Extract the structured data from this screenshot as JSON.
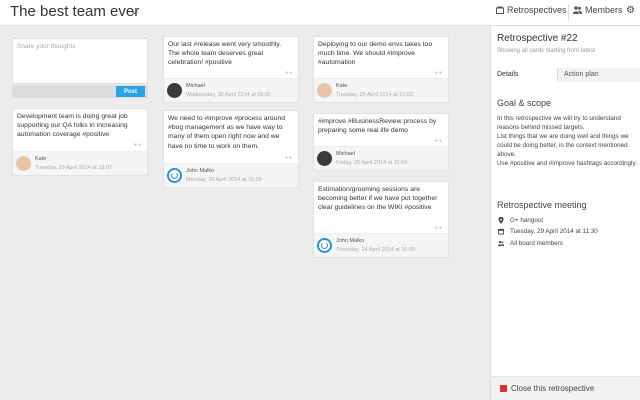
{
  "header": {
    "board_title": "The best team ever",
    "retrospectives_label": "Retrospectives",
    "members_label": "Members"
  },
  "composer": {
    "placeholder": "Share your thoughts",
    "post_label": "Post"
  },
  "cards": [
    {
      "text": "Development team is doing great job supporting our QA folks in increasing automation coverage #positive",
      "author": "Kate",
      "date": "Tuesday, 29 April 2014 at 18:07",
      "avatar": "photo"
    },
    {
      "text": "Our last #release went very smoothly. The whole team deserves great celebration! #positive",
      "author": "Michael",
      "date": "Wednesday, 30 April 2014 at 09:05",
      "avatar": "photo-dark"
    },
    {
      "text": "We need to #improve #process around #bug management as we have way to many of them open right now and we have no time to work on them.",
      "author": "John Malko",
      "date": "Monday, 28 April 2014 at 16:09",
      "avatar": "logo-blue"
    },
    {
      "text": "Deploying to our demo envs takes too much time. We should #improve #automation",
      "author": "Kate",
      "date": "Tuesday, 29 April 2014 at 21:03",
      "avatar": "photo"
    },
    {
      "text": "#improve #BusinessReview process by preparing some real life demo",
      "author": "Michael",
      "date": "Friday, 25 April 2014 at 11:04",
      "avatar": "photo-dark"
    },
    {
      "text": "Estimation/grooming sessions are becoming better if we have put together clear guidelines on the WIKI #positive",
      "author": "John Malko",
      "date": "Thursday, 24 April 2014 at 16:09",
      "avatar": "logo-blue"
    }
  ],
  "panel": {
    "title": "Retrospective #22",
    "subtitle": "Showing all cards starting from latest",
    "tabs": [
      "Details",
      "Action plan"
    ],
    "goal_title": "Goal & scope",
    "goal_lines": [
      "In this retrospective we will try to understand reasons behind missed targets.",
      "List things that we are doing well and things we could be doing better, in the context mentioned above.",
      "Use #positive and #improve hashtags accordingly."
    ],
    "meeting_title": "Retrospective meeting",
    "location": "G+ hangout",
    "datetime": "Tuesday, 29 April 2014 at 11:30",
    "attendees": "All board members",
    "close_label": "Close this retrospective"
  },
  "colors": {
    "accent": "#29a3e3",
    "danger": "#d9302b"
  },
  "icons": [
    "chevron-down-icon",
    "retrospectives-icon",
    "members-icon",
    "gear-icon",
    "location-pin-icon",
    "calendar-icon",
    "members-icon",
    "close-square-icon"
  ]
}
